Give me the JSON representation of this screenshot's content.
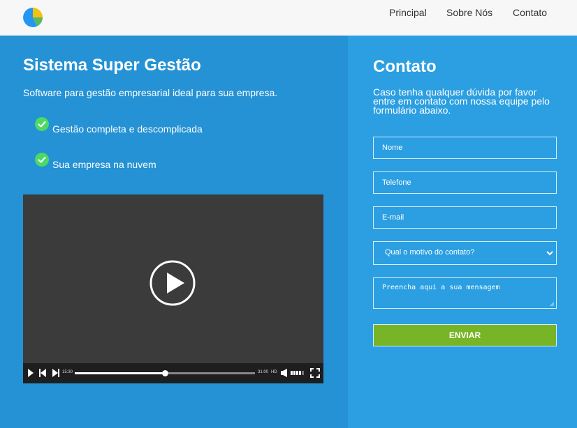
{
  "nav": {
    "items": [
      {
        "label": "Principal"
      },
      {
        "label": "Sobre Nós"
      },
      {
        "label": "Contato"
      }
    ]
  },
  "hero": {
    "title": "Sistema Super Gestão",
    "subtitle": "Software para gestão empresarial ideal para sua empresa.",
    "features": [
      {
        "text": "Gestão completa e descomplicada",
        "icon": "check-circle-icon"
      },
      {
        "text": "Sua empresa na nuvem",
        "icon": "check-circle-icon"
      }
    ]
  },
  "video": {
    "current_time": "15:30",
    "duration": "31:00",
    "quality": "HD",
    "progress": 0.5,
    "icons": [
      "play-icon",
      "skip-back-icon",
      "skip-forward-icon",
      "volume-icon",
      "fullscreen-icon"
    ]
  },
  "contact": {
    "title": "Contato",
    "description": "Caso tenha qualquer dúvida por favor entre em contato com nossa equipe pelo formulário abaixo.",
    "fields": {
      "name_placeholder": "Nome",
      "phone_placeholder": "Telefone",
      "email_placeholder": "E-mail",
      "reason_selected": "Qual o motivo do contato?",
      "message_placeholder": "Preencha aqui a sua mensagem"
    },
    "submit_label": "ENVIAR"
  },
  "colors": {
    "left_panel": "#2492d4",
    "right_panel": "#2b9fe1",
    "submit": "#78b526",
    "check": "#4cd964",
    "video_bg": "#3b3b3b"
  }
}
